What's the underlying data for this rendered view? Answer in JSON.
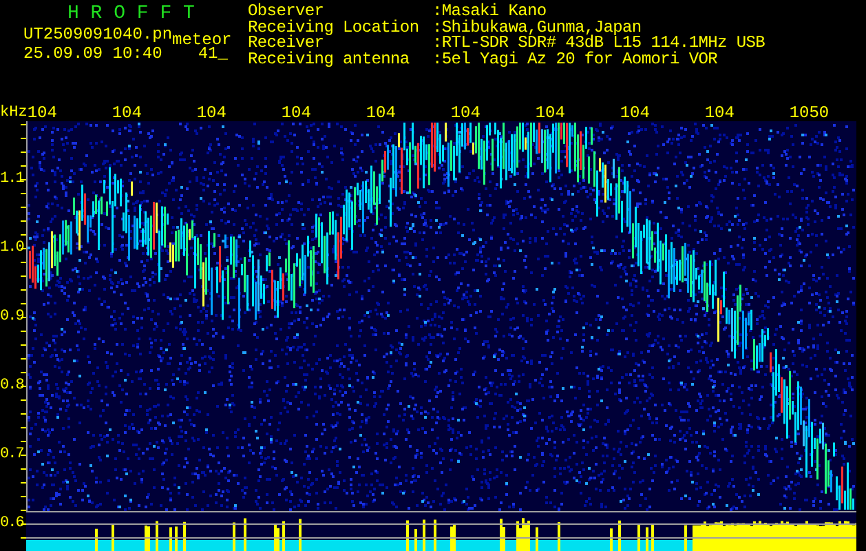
{
  "app_title": "H R O F F T",
  "file": {
    "name": "UT2509091040.pn",
    "tag": "meteor",
    "timestamp": "25.09.09 10:40",
    "count": "41_"
  },
  "info": [
    {
      "label": "Observer",
      "value": ":Masaki Kano"
    },
    {
      "label": "Receiving Location",
      "value": ":Shibukawa,Gunma,Japan"
    },
    {
      "label": "Receiver",
      "value": ":RTL-SDR SDR# 43dB L15 114.1MHz USB"
    },
    {
      "label": "Receiving antenna",
      "value": ":5el Yagi Az 20 for Aomori VOR"
    }
  ],
  "axis": {
    "unit": "kHz",
    "x_labels": [
      "104",
      "104",
      "104",
      "104",
      "104",
      "104",
      "104",
      "104",
      "104",
      "1050"
    ],
    "y_labels": [
      "1.1",
      "1.0",
      "0.9",
      "0.8",
      "0.7",
      "0.6"
    ]
  }
}
